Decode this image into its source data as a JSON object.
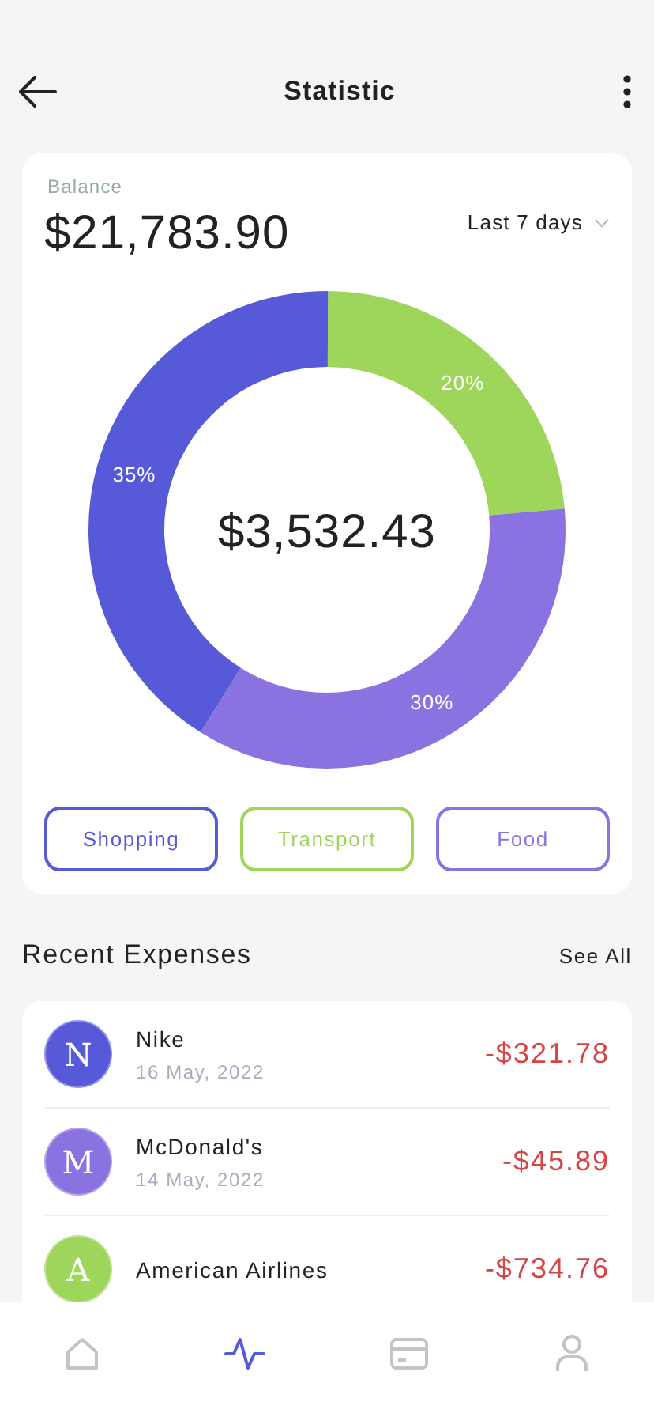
{
  "header": {
    "title": "Statistic"
  },
  "balance": {
    "label": "Balance",
    "amount": "$21,783.90",
    "period": "Last 7 days",
    "total": "$3,532.43",
    "chart_data": {
      "type": "donut",
      "categories": [
        "Shopping",
        "Transport",
        "Food"
      ],
      "values": [
        35,
        20,
        30
      ],
      "value_labels": [
        "35%",
        "20%",
        "30%"
      ]
    }
  },
  "legend": [
    {
      "color": "#5659d8"
    },
    {
      "color": "#9dd65a"
    },
    {
      "color": "#8a72e0"
    }
  ],
  "expenses": {
    "title": "Recent Expenses",
    "see_all": "See All",
    "items": [
      {
        "initial": "N",
        "name": "Nike",
        "date": "16 May, 2022",
        "amount": "-$321.78",
        "color": "#5659d8"
      },
      {
        "initial": "M",
        "name": "McDonald's",
        "date": "14 May, 2022",
        "amount": "-$45.89",
        "color": "#8a72e0"
      },
      {
        "initial": "A",
        "name": "American Airlines",
        "amount": "-$734.76",
        "color": "#9dd65a"
      }
    ]
  },
  "nav": [
    {
      "kind": "home",
      "selected": false
    },
    {
      "kind": "activity",
      "selected": true
    },
    {
      "kind": "card",
      "selected": false
    },
    {
      "kind": "profile",
      "selected": false
    }
  ]
}
